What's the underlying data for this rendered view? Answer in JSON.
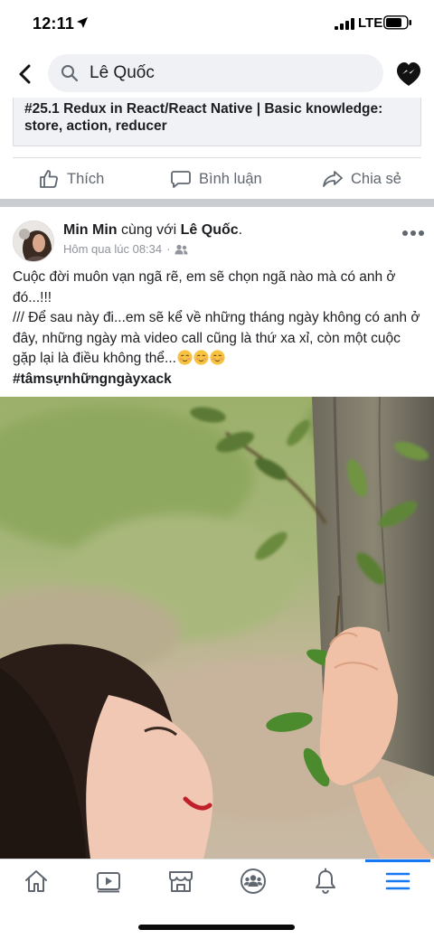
{
  "status_bar": {
    "time": "12:11",
    "network": "LTE"
  },
  "search": {
    "query": "Lê Quốc"
  },
  "link_preview": {
    "title": "#25.1 Redux in React/React Native | Basic knowledge: store, action, reducer"
  },
  "actions": {
    "like": "Thích",
    "comment": "Bình luận",
    "share": "Chia sẻ"
  },
  "post": {
    "author": "Min Min",
    "with_text": "cùng với",
    "tagged": "Lê Quốc",
    "tagged_suffix": ".",
    "timestamp": "Hôm qua lúc 08:34",
    "dot": "·",
    "text_line1": "Cuộc đời muôn vạn ngã rẽ, em sẽ chọn ngã nào mà có anh ở đó...!!!",
    "text_line2": "/// Để sau này đi...em sẽ kể về những tháng ngày không có anh ở đây, những ngày mà video call cũng là thứ xa xỉ, còn một cuộc gặp lại là điều không thể...",
    "hashtag": "#tâmsựnhữngngàyxack"
  },
  "tabs": [
    "home-icon",
    "watch-icon",
    "marketplace-icon",
    "groups-icon",
    "notifications-icon",
    "menu-icon"
  ],
  "colors": {
    "accent": "#1877f2",
    "text": "#1c1e21",
    "muted": "#606770"
  }
}
